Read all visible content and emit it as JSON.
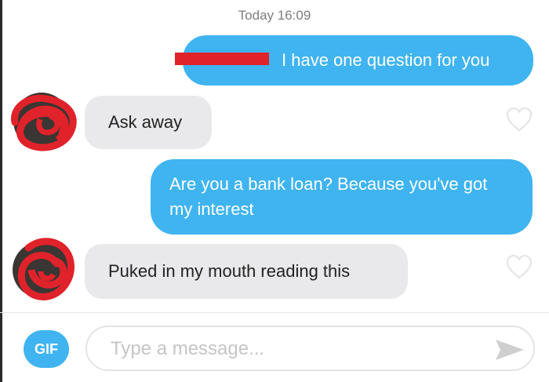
{
  "chat": {
    "timestamp": "Today 16:09",
    "messages": [
      {
        "direction": "outgoing",
        "text": "I have one question for you",
        "redacted_prefix": true
      },
      {
        "direction": "incoming",
        "text": "Ask away",
        "liked": false
      },
      {
        "direction": "outgoing",
        "text": "Are you a bank loan? Because you've got my interest"
      },
      {
        "direction": "incoming",
        "text": "Puked in my mouth reading this",
        "liked": false
      }
    ]
  },
  "composer": {
    "gif_label": "GIF",
    "placeholder": "Type a message...",
    "send_icon": "send-icon"
  },
  "colors": {
    "accent": "#3fb4f0",
    "incoming_bubble": "#e9e9eb",
    "redaction": "#e0222a"
  }
}
